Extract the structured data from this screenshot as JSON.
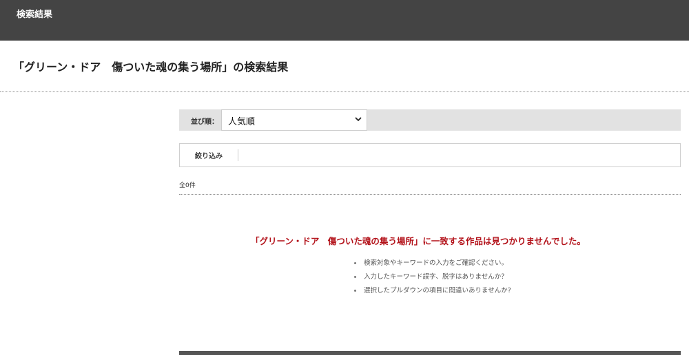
{
  "header": {
    "title": "検索結果"
  },
  "search": {
    "heading": "「グリーン・ドア　傷ついた魂の集う場所」の検索結果"
  },
  "sort": {
    "label": "並び順：",
    "selected": "人気順"
  },
  "filter": {
    "label": "絞り込み"
  },
  "results": {
    "count_text": "全0件",
    "no_result_message": "「グリーン・ドア　傷ついた魂の集う場所」に一致する作品は見つかりませんでした。",
    "hints": [
      "検索対象やキーワードの入力をご確認ください。",
      "入力したキーワード誤字、脱字はありませんか？",
      "選択したプルダウンの項目に間違いありませんか?"
    ]
  },
  "colors": {
    "header_bg": "#444444",
    "error_text": "#b3121a",
    "sortbar_bg": "#e2e2e2"
  }
}
